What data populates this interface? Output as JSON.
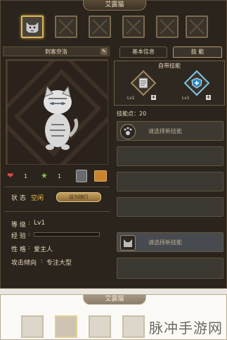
{
  "window_title": "艾露猫",
  "slots_count": 6,
  "left": {
    "name": "刺客奈洛",
    "edit_icon": "pencil-icon",
    "hearts": "1",
    "stars": "1",
    "status_label": "状 态",
    "status_value": "空闲",
    "status_button": "设为随行",
    "level_label": "等 级",
    "level_value": "Lv1",
    "exp_label": "经 验",
    "personality_label": "性 格",
    "personality_value": "爱主人",
    "attack_label": "攻击倾向",
    "attack_value": "专注大型"
  },
  "tabs": [
    {
      "label": "基本信息",
      "active": false
    },
    {
      "label": "技 能",
      "active": true
    }
  ],
  "innate": {
    "title": "自带技能",
    "skill1_level": "Lv1",
    "skill2_level": "Lv1"
  },
  "skill_points": "技能点：20",
  "skill_slot1": "请选择新技能",
  "skill_slot2": "请选择新技能",
  "bottom": {
    "title": "艾露猫",
    "watermark": "脉冲手游网"
  },
  "colors": {
    "gold": "#f2c350",
    "panel": "#2a241d",
    "border": "#7b6a4e"
  }
}
